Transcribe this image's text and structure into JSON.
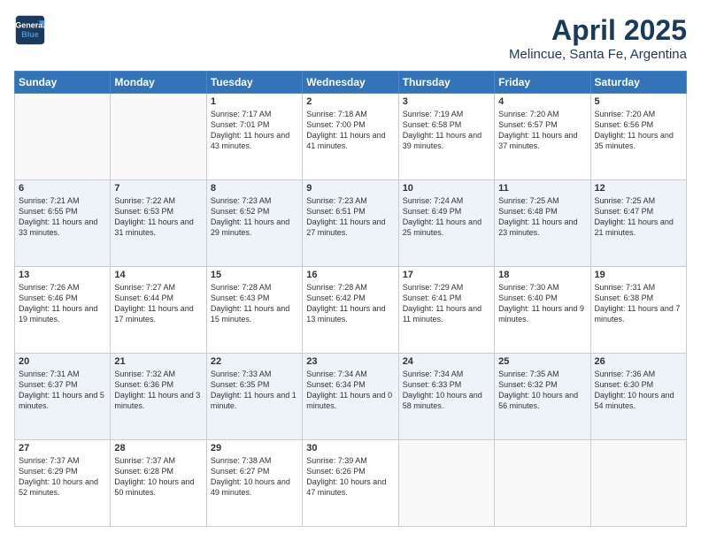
{
  "header": {
    "logo_line1": "General",
    "logo_line2": "Blue",
    "month": "April 2025",
    "location": "Melincue, Santa Fe, Argentina"
  },
  "weekdays": [
    "Sunday",
    "Monday",
    "Tuesday",
    "Wednesday",
    "Thursday",
    "Friday",
    "Saturday"
  ],
  "weeks": [
    [
      {
        "day": "",
        "info": ""
      },
      {
        "day": "",
        "info": ""
      },
      {
        "day": "1",
        "info": "Sunrise: 7:17 AM\nSunset: 7:01 PM\nDaylight: 11 hours and 43 minutes."
      },
      {
        "day": "2",
        "info": "Sunrise: 7:18 AM\nSunset: 7:00 PM\nDaylight: 11 hours and 41 minutes."
      },
      {
        "day": "3",
        "info": "Sunrise: 7:19 AM\nSunset: 6:58 PM\nDaylight: 11 hours and 39 minutes."
      },
      {
        "day": "4",
        "info": "Sunrise: 7:20 AM\nSunset: 6:57 PM\nDaylight: 11 hours and 37 minutes."
      },
      {
        "day": "5",
        "info": "Sunrise: 7:20 AM\nSunset: 6:56 PM\nDaylight: 11 hours and 35 minutes."
      }
    ],
    [
      {
        "day": "6",
        "info": "Sunrise: 7:21 AM\nSunset: 6:55 PM\nDaylight: 11 hours and 33 minutes."
      },
      {
        "day": "7",
        "info": "Sunrise: 7:22 AM\nSunset: 6:53 PM\nDaylight: 11 hours and 31 minutes."
      },
      {
        "day": "8",
        "info": "Sunrise: 7:23 AM\nSunset: 6:52 PM\nDaylight: 11 hours and 29 minutes."
      },
      {
        "day": "9",
        "info": "Sunrise: 7:23 AM\nSunset: 6:51 PM\nDaylight: 11 hours and 27 minutes."
      },
      {
        "day": "10",
        "info": "Sunrise: 7:24 AM\nSunset: 6:49 PM\nDaylight: 11 hours and 25 minutes."
      },
      {
        "day": "11",
        "info": "Sunrise: 7:25 AM\nSunset: 6:48 PM\nDaylight: 11 hours and 23 minutes."
      },
      {
        "day": "12",
        "info": "Sunrise: 7:25 AM\nSunset: 6:47 PM\nDaylight: 11 hours and 21 minutes."
      }
    ],
    [
      {
        "day": "13",
        "info": "Sunrise: 7:26 AM\nSunset: 6:46 PM\nDaylight: 11 hours and 19 minutes."
      },
      {
        "day": "14",
        "info": "Sunrise: 7:27 AM\nSunset: 6:44 PM\nDaylight: 11 hours and 17 minutes."
      },
      {
        "day": "15",
        "info": "Sunrise: 7:28 AM\nSunset: 6:43 PM\nDaylight: 11 hours and 15 minutes."
      },
      {
        "day": "16",
        "info": "Sunrise: 7:28 AM\nSunset: 6:42 PM\nDaylight: 11 hours and 13 minutes."
      },
      {
        "day": "17",
        "info": "Sunrise: 7:29 AM\nSunset: 6:41 PM\nDaylight: 11 hours and 11 minutes."
      },
      {
        "day": "18",
        "info": "Sunrise: 7:30 AM\nSunset: 6:40 PM\nDaylight: 11 hours and 9 minutes."
      },
      {
        "day": "19",
        "info": "Sunrise: 7:31 AM\nSunset: 6:38 PM\nDaylight: 11 hours and 7 minutes."
      }
    ],
    [
      {
        "day": "20",
        "info": "Sunrise: 7:31 AM\nSunset: 6:37 PM\nDaylight: 11 hours and 5 minutes."
      },
      {
        "day": "21",
        "info": "Sunrise: 7:32 AM\nSunset: 6:36 PM\nDaylight: 11 hours and 3 minutes."
      },
      {
        "day": "22",
        "info": "Sunrise: 7:33 AM\nSunset: 6:35 PM\nDaylight: 11 hours and 1 minute."
      },
      {
        "day": "23",
        "info": "Sunrise: 7:34 AM\nSunset: 6:34 PM\nDaylight: 11 hours and 0 minutes."
      },
      {
        "day": "24",
        "info": "Sunrise: 7:34 AM\nSunset: 6:33 PM\nDaylight: 10 hours and 58 minutes."
      },
      {
        "day": "25",
        "info": "Sunrise: 7:35 AM\nSunset: 6:32 PM\nDaylight: 10 hours and 56 minutes."
      },
      {
        "day": "26",
        "info": "Sunrise: 7:36 AM\nSunset: 6:30 PM\nDaylight: 10 hours and 54 minutes."
      }
    ],
    [
      {
        "day": "27",
        "info": "Sunrise: 7:37 AM\nSunset: 6:29 PM\nDaylight: 10 hours and 52 minutes."
      },
      {
        "day": "28",
        "info": "Sunrise: 7:37 AM\nSunset: 6:28 PM\nDaylight: 10 hours and 50 minutes."
      },
      {
        "day": "29",
        "info": "Sunrise: 7:38 AM\nSunset: 6:27 PM\nDaylight: 10 hours and 49 minutes."
      },
      {
        "day": "30",
        "info": "Sunrise: 7:39 AM\nSunset: 6:26 PM\nDaylight: 10 hours and 47 minutes."
      },
      {
        "day": "",
        "info": ""
      },
      {
        "day": "",
        "info": ""
      },
      {
        "day": "",
        "info": ""
      }
    ]
  ]
}
